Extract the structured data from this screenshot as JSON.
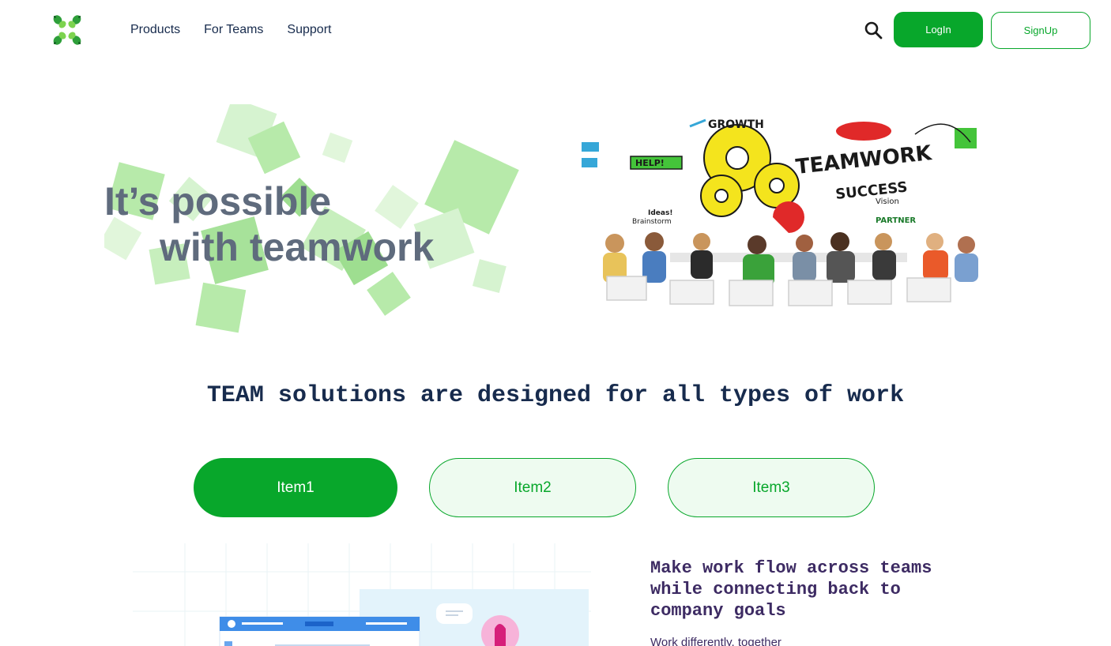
{
  "header": {
    "logo_icon": "four-leaf-logo-icon",
    "nav": [
      "Products",
      "For Teams",
      "Support"
    ],
    "search_icon": "search-icon",
    "login_label": "LogIn",
    "signup_label": "SignUp"
  },
  "hero": {
    "line1": "It’s possible",
    "line2": "with teamwork",
    "image_words": [
      "GROWTH",
      "TEAMWORK",
      "SUCCESS",
      "HELP!",
      "Vision",
      "Ideas!",
      "Brainstorm",
      "PARTNER"
    ]
  },
  "section": {
    "title": "TEAM solutions are designed for all types of work"
  },
  "tabs": [
    {
      "label": "Item1",
      "active": true
    },
    {
      "label": "Item2",
      "active": false
    },
    {
      "label": "Item3",
      "active": false
    }
  ],
  "feature": {
    "title": "Make work flow across teams while connecting back to company goals",
    "subtitle": "Work differently, together"
  },
  "colors": {
    "brand_green": "#08a72b",
    "tab_inactive_bg": "#eefbf0",
    "hero_text": "#5f6b7d",
    "heading_navy": "#172b4d",
    "feature_purple": "#3d2b63"
  }
}
